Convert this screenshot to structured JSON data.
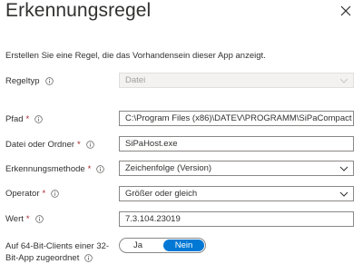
{
  "panel": {
    "title": "Erkennungsregel"
  },
  "description": "Erstellen Sie eine Regel, die das Vorhandensein dieser App anzeigt.",
  "fields": {
    "regeltyp": {
      "label": "Regeltyp",
      "value": "Datei"
    },
    "pfad": {
      "label": "Pfad",
      "required": "*",
      "value": "C:\\Program Files (x86)\\DATEV\\PROGRAMM\\SiPaCompact"
    },
    "datei": {
      "label": "Datei oder Ordner",
      "required": "*",
      "value": "SiPaHost.exe"
    },
    "methode": {
      "label": "Erkennungsmethode",
      "required": "*",
      "value": "Zeichenfolge (Version)"
    },
    "operator": {
      "label": "Operator",
      "required": "*",
      "value": "Größer oder gleich"
    },
    "wert": {
      "label": "Wert",
      "required": "*",
      "value": "7.3.104.23019"
    }
  },
  "toggle_row": {
    "label_line1": "Auf 64-Bit-Clients einer 32-",
    "label_line2": "Bit-App zugeordnet",
    "option_yes": "Ja",
    "option_no": "Nein",
    "selected": "Nein"
  },
  "icons": {
    "close": "close-icon",
    "info": "info-icon",
    "dropdown": "chevron-down-icon"
  },
  "colors": {
    "accent": "#0078d4",
    "required": "#a4262c",
    "border": "#8a8886"
  }
}
